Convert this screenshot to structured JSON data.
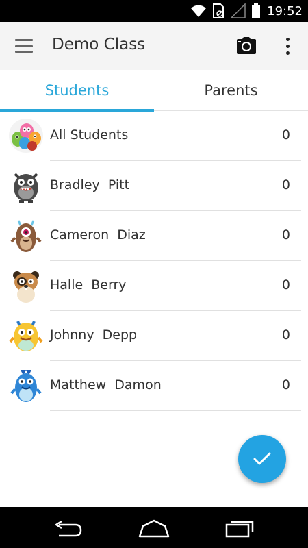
{
  "status_bar": {
    "time": "19:52",
    "icons": [
      "wifi-icon",
      "sim-icon",
      "signal-icon",
      "battery-icon"
    ]
  },
  "app_bar": {
    "title": "Demo Class",
    "menu_icon": "menu-icon",
    "camera_icon": "camera-icon",
    "more_icon": "more-vertical-icon"
  },
  "tabs": [
    {
      "label": "Students",
      "active": true
    },
    {
      "label": "Parents",
      "active": false
    }
  ],
  "students": [
    {
      "name": "All Students",
      "points": "0",
      "avatar": "all-students-avatar"
    },
    {
      "name": "Bradley  Pitt",
      "points": "0",
      "avatar": "gray-monster-avatar"
    },
    {
      "name": "Cameron  Diaz",
      "points": "0",
      "avatar": "brown-cyclops-avatar"
    },
    {
      "name": "Halle  Berry",
      "points": "0",
      "avatar": "hamster-avatar"
    },
    {
      "name": "Johnny  Depp",
      "points": "0",
      "avatar": "yellow-monster-avatar"
    },
    {
      "name": "Matthew  Damon",
      "points": "0",
      "avatar": "blue-monster-avatar"
    }
  ],
  "fab": {
    "icon": "checkmark-icon"
  },
  "nav_bar": {
    "icons": [
      "back-icon",
      "home-icon",
      "recent-apps-icon"
    ]
  },
  "colors": {
    "accent": "#2aa7d9",
    "fab": "#23a3e2"
  }
}
